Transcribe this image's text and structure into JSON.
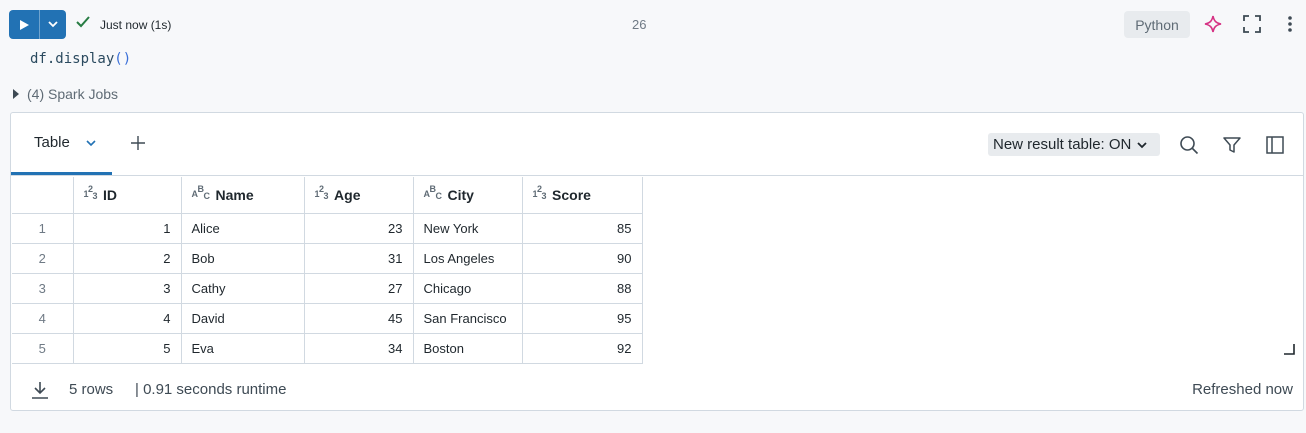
{
  "cell": {
    "status": "Just now (1s)",
    "number": "26",
    "language": "Python",
    "code": {
      "object": "df",
      "method": ".display",
      "parens": "()"
    },
    "spark_jobs": "(4) Spark Jobs"
  },
  "results": {
    "tab_label": "Table",
    "new_result_toggle": "New result table: ON",
    "columns": [
      {
        "name": "ID",
        "type": "1²₃"
      },
      {
        "name": "Name",
        "type": "ABC"
      },
      {
        "name": "Age",
        "type": "1²₃"
      },
      {
        "name": "City",
        "type": "ABC"
      },
      {
        "name": "Score",
        "type": "1²₃"
      }
    ],
    "rows": [
      {
        "rn": "1",
        "id": "1",
        "name": "Alice",
        "age": "23",
        "city": "New York",
        "score": "85"
      },
      {
        "rn": "2",
        "id": "2",
        "name": "Bob",
        "age": "31",
        "city": "Los Angeles",
        "score": "90"
      },
      {
        "rn": "3",
        "id": "3",
        "name": "Cathy",
        "age": "27",
        "city": "Chicago",
        "score": "88"
      },
      {
        "rn": "4",
        "id": "4",
        "name": "David",
        "age": "45",
        "city": "San Francisco",
        "score": "95"
      },
      {
        "rn": "5",
        "id": "5",
        "name": "Eva",
        "age": "34",
        "city": "Boston",
        "score": "92"
      }
    ],
    "footer": {
      "rows": "5 rows",
      "runtime": "|  0.91 seconds runtime",
      "refreshed": "Refreshed now"
    }
  },
  "colors": {
    "accent": "#2272b4",
    "success": "#277c43",
    "assistant": "#d63384"
  }
}
